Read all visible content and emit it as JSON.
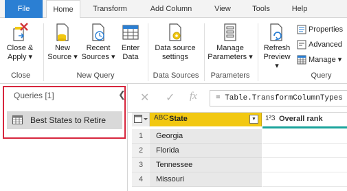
{
  "tabs": [
    {
      "label": "File"
    },
    {
      "label": "Home"
    },
    {
      "label": "Transform"
    },
    {
      "label": "Add Column"
    },
    {
      "label": "View"
    },
    {
      "label": "Tools"
    },
    {
      "label": "Help"
    }
  ],
  "ribbon": {
    "close_apply": "Close &",
    "close_apply2": "Apply ▾",
    "group_close": "Close",
    "new_source": "New",
    "new_source2": "Source ▾",
    "recent_sources": "Recent",
    "recent_sources2": "Sources ▾",
    "enter_data": "Enter",
    "enter_data2": "Data",
    "group_new_query": "New Query",
    "ds_settings": "Data source",
    "ds_settings2": "settings",
    "group_data_sources": "Data Sources",
    "manage_params": "Manage",
    "manage_params2": "Parameters ▾",
    "group_parameters": "Parameters",
    "refresh_preview": "Refresh",
    "refresh_preview2": "Preview ▾",
    "properties": "Properties",
    "advanced": "Advanced",
    "manage": "Manage ▾",
    "group_query": "Query"
  },
  "queries": {
    "title": "Queries [1]",
    "collapse": "❮",
    "items": [
      {
        "label": "Best States to Retire"
      }
    ]
  },
  "formula": {
    "cancel": "✕",
    "commit": "✓",
    "fx": "fx",
    "text": "= Table.TransformColumnTypes"
  },
  "grid": {
    "columns": [
      {
        "type": "ABC",
        "name": "State"
      },
      {
        "type": "1²3",
        "name": "Overall rank"
      }
    ],
    "rows": [
      {
        "num": "1",
        "state": "Georgia"
      },
      {
        "num": "2",
        "state": "Florida"
      },
      {
        "num": "3",
        "state": "Tennessee"
      },
      {
        "num": "4",
        "state": "Missouri"
      }
    ]
  },
  "colors": {
    "accent": "#2b7fd3",
    "column_selected": "#f2c811",
    "quality_bar": "#1aa39b",
    "highlight_box": "#d7263d"
  }
}
